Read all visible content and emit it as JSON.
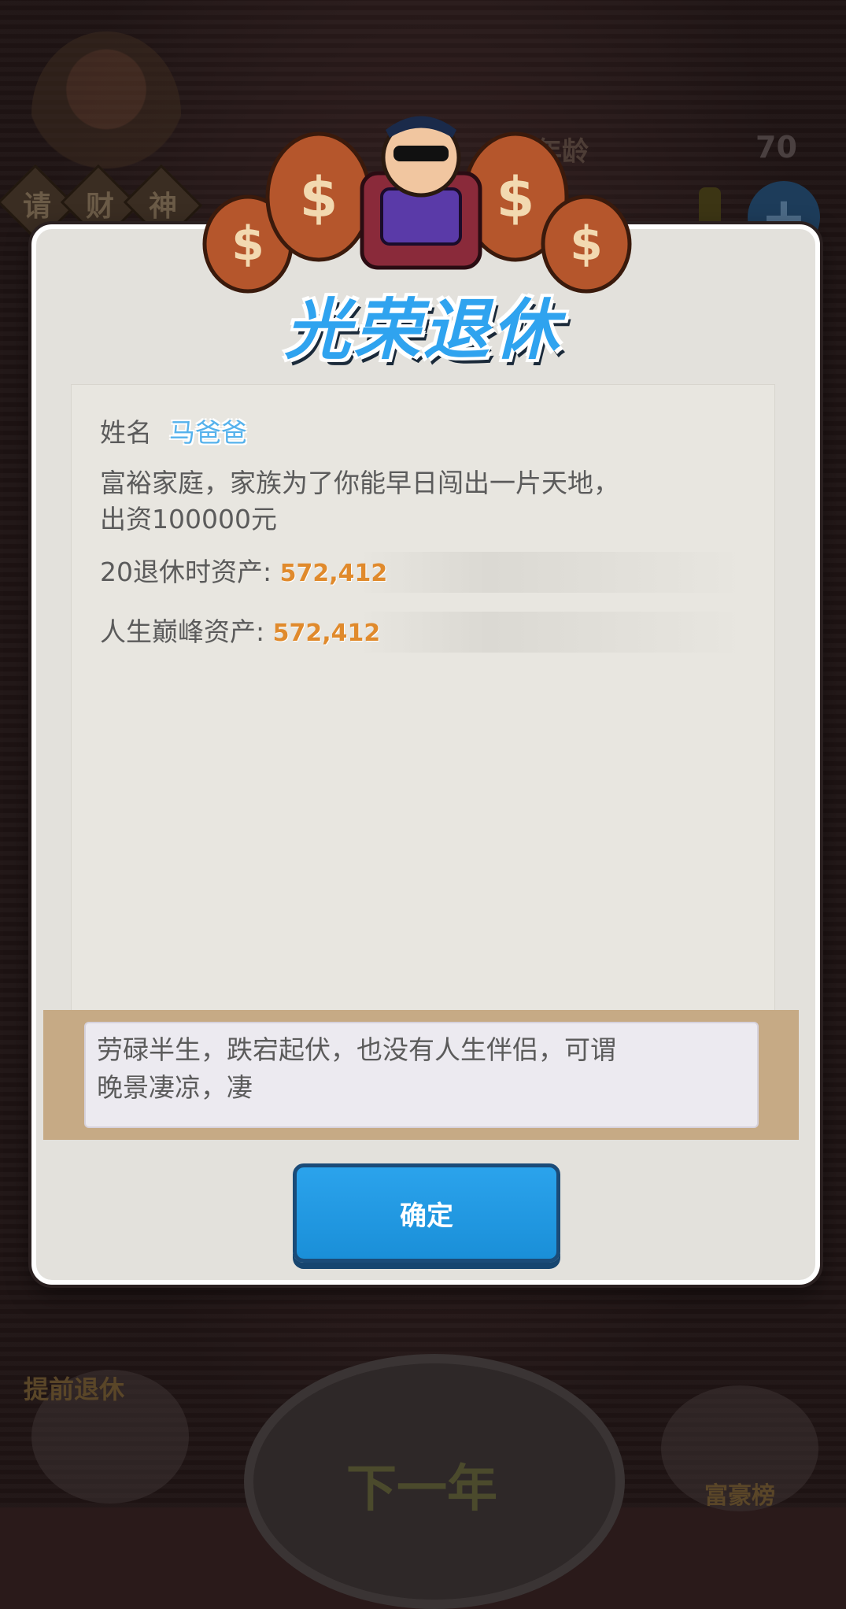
{
  "background": {
    "god_label": [
      "请",
      "财",
      "神"
    ],
    "age_label": "年龄",
    "age_value": "70",
    "early_retire_label": "提前退休",
    "next_year_label": "下一年",
    "rich_list_label": "富豪榜"
  },
  "modal": {
    "title": "光荣退休",
    "name_label": "姓名",
    "name_value": "马爸爸",
    "description_line1": "富裕家庭，家族为了你能早日闯出一片天地，",
    "description_line2": "出资100000元",
    "retire_assets_label": "20退休时资产:",
    "retire_assets_value": "572,412",
    "peak_assets_label": "人生巅峰资产:",
    "peak_assets_value": "572,412",
    "comment_line1": "劳碌半生，跌宕起伏，也没有人生伴侣，可谓",
    "comment_line2": "晚景凄凉，凄",
    "confirm_label": "确定"
  },
  "colors": {
    "title_blue": "#2fa3ef",
    "value_orange": "#e08a2c",
    "button_blue": "#1a8fd8",
    "panel_bg": "#e3e1dc"
  }
}
